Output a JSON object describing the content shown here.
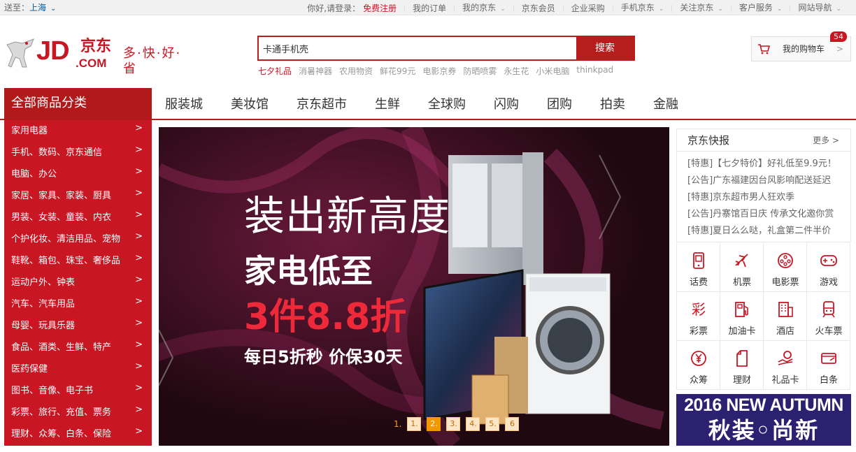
{
  "topbar": {
    "location_label": "送至：",
    "location_city": "上海",
    "greeting": "你好,请登录：",
    "register": "免费注册",
    "links": [
      "我的订单",
      "我的京东",
      "京东会员",
      "企业采购",
      "手机京东",
      "关注京东",
      "客户服务",
      "网站导航"
    ]
  },
  "logo": {
    "jd": "JD",
    "com": ".COM",
    "cn": "京东",
    "slogan": "多·快·好·省"
  },
  "search": {
    "value": "卡通手机壳",
    "button": "搜索",
    "hotwords": [
      "七夕礼品",
      "消暑神器",
      "农用物资",
      "鲜花99元",
      "电影京券",
      "防晒喷雾",
      "永生花",
      "小米电脑",
      "thinkpad"
    ]
  },
  "cart": {
    "label": "我的购物车",
    "count": "54",
    "arrow": ">"
  },
  "nav": {
    "all_categories": "全部商品分类",
    "items": [
      "服装城",
      "美妆馆",
      "京东超市",
      "生鲜",
      "全球购",
      "闪购",
      "团购",
      "拍卖",
      "金融"
    ]
  },
  "categories": [
    "家用电器",
    "手机、数码、京东通信",
    "电脑、办公",
    "家居、家具、家装、厨具",
    "男装、女装、童装、内衣",
    "个护化妆、清洁用品、宠物",
    "鞋靴、箱包、珠宝、奢侈品",
    "运动户外、钟表",
    "汽车、汽车用品",
    "母婴、玩具乐器",
    "食品、酒类、生鲜、特产",
    "医药保健",
    "图书、音像、电子书",
    "彩票、旅行、充值、票务",
    "理财、众筹、白条、保险"
  ],
  "banner": {
    "line1": "装出新高度",
    "line2": "家电低至",
    "line3": "3件8.8折",
    "line4": "每日5折秒  价保30天",
    "dots_label": "1.",
    "dots": [
      "1.",
      "2.",
      "3.",
      "4.",
      "5.",
      "6"
    ],
    "active_dot": 2
  },
  "news": {
    "title": "京东快报",
    "more": "更多 >",
    "items": [
      "[特惠]【七夕特价】好礼低至9.9元！",
      "[公告]广东福建因台风影响配送延迟",
      "[特惠]京东超市男人狂欢季",
      "[公告]丹寨馆百日庆 传承文化邀你赏",
      "[特惠]夏日么么哒，礼盒第二件半价"
    ]
  },
  "services": [
    {
      "label": "话费",
      "icon": "phone-icon"
    },
    {
      "label": "机票",
      "icon": "plane-icon"
    },
    {
      "label": "电影票",
      "icon": "film-reel-icon"
    },
    {
      "label": "游戏",
      "icon": "gamepad-icon"
    },
    {
      "label": "彩票",
      "icon": "lottery-icon"
    },
    {
      "label": "加油卡",
      "icon": "fuel-icon"
    },
    {
      "label": "酒店",
      "icon": "hotel-icon"
    },
    {
      "label": "火车票",
      "icon": "train-icon"
    },
    {
      "label": "众筹",
      "icon": "yen-coin-icon"
    },
    {
      "label": "理财",
      "icon": "document-icon"
    },
    {
      "label": "礼品卡",
      "icon": "gift-card-icon"
    },
    {
      "label": "白条",
      "icon": "credit-card-icon"
    }
  ],
  "autumn_ad": {
    "line1": "2016 NEW AUTUMN",
    "line2": "秋装◦尚新"
  },
  "colors": {
    "brand_red": "#c81623",
    "nav_red": "#b1191a",
    "autumn_bg": "#2b2170"
  }
}
